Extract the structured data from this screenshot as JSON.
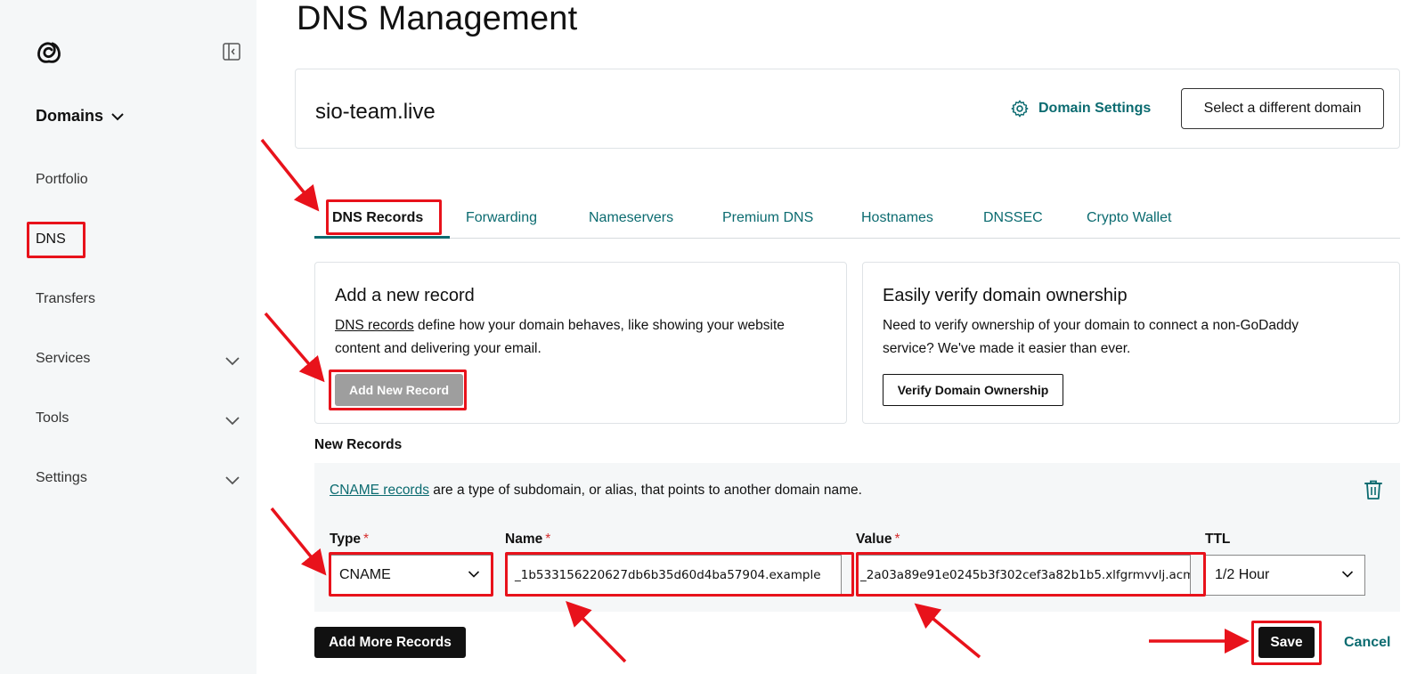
{
  "page": {
    "title": "DNS Management"
  },
  "sidebar": {
    "logo_icon": "godaddy-logo-icon",
    "collapse_icon": "sidebar-collapse-icon",
    "heading": "Domains",
    "items": [
      {
        "label": "Portfolio"
      },
      {
        "label": "DNS"
      },
      {
        "label": "Transfers"
      },
      {
        "label": "Services"
      },
      {
        "label": "Tools"
      },
      {
        "label": "Settings"
      }
    ]
  },
  "domain": {
    "name": "sio-team.live",
    "settings_label": "Domain Settings",
    "settings_icon": "gear-icon",
    "select_label": "Select a different domain"
  },
  "tabs": [
    {
      "label": "DNS Records"
    },
    {
      "label": "Forwarding"
    },
    {
      "label": "Nameservers"
    },
    {
      "label": "Premium DNS"
    },
    {
      "label": "Hostnames"
    },
    {
      "label": "DNSSEC"
    },
    {
      "label": "Crypto Wallet"
    }
  ],
  "add_card": {
    "title": "Add a new record",
    "link_text": "DNS records",
    "text": " define how your domain behaves, like showing your website content and delivering your email.",
    "button": "Add New Record"
  },
  "verify_card": {
    "title": "Easily verify domain ownership",
    "text": "Need to verify ownership of your domain to connect a non-GoDaddy service? We've made it easier than ever.",
    "button": "Verify Domain Ownership"
  },
  "new_records": {
    "heading": "New Records",
    "link_text": "CNAME records",
    "description": " are a type of subdomain, or alias, that points to another domain name.",
    "delete_icon": "trash-icon",
    "fields": {
      "type_label": "Type",
      "type_value": "CNAME",
      "name_label": "Name",
      "name_value": "_1b533156220627db6b35d60d4ba57904.example",
      "value_label": "Value",
      "value_value": "_2a03a89e91e0245b3f302cef3a82b1b5.xlfgrmvvlj.acm",
      "ttl_label": "TTL",
      "ttl_value": "1/2 Hour",
      "required_mark": "*"
    }
  },
  "actions": {
    "add_more": "Add More Records",
    "save": "Save",
    "cancel": "Cancel"
  },
  "colors": {
    "accent": "#0b6b70",
    "highlight": "#e8121b",
    "sidebar_bg": "#f5f7f8"
  }
}
